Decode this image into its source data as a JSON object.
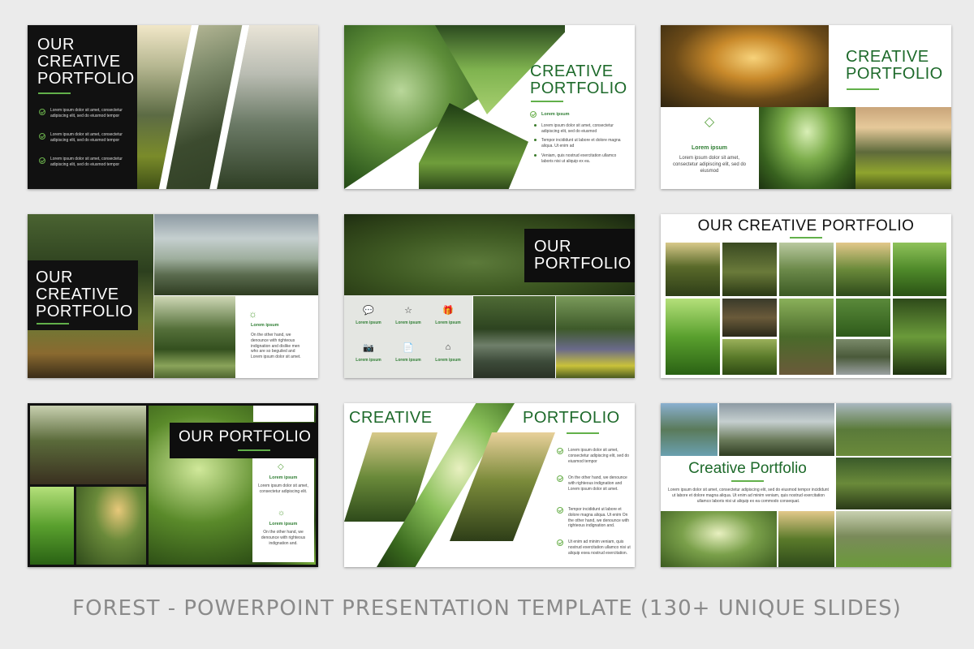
{
  "colors": {
    "brand_green": "#1e6a2b",
    "accent_green": "#62b04a",
    "dark": "#101010"
  },
  "slides": [
    {
      "title": "OUR\nCREATIVE\nPORTFOLIO",
      "bullets": [
        "Lorem ipsum dolor sit amet, consectetur adipiscing elit, sed do eiusmod tempor",
        "Lorem ipsum dolor sit amet, consectetur adipiscing elit, sed do eiusmod tempor",
        "Lorem ipsum dolor sit amet, consectetur adipiscing elit, sed do eiusmod tempor"
      ]
    },
    {
      "title": "CREATIVE\nPORTFOLIO",
      "heading": "Lorem ipsum",
      "bullets": [
        "Lorem ipsum dolor sit amet, consectetur adipiscing elit, sed do eiusmod",
        "Tempor incididunt ut labore et dolore magna aliqua. Ut enim ad",
        "Veniam, quis nostrud exercitation ullamco laboris nisi ut aliquip ex ea."
      ]
    },
    {
      "title": "CREATIVE\nPORTFOLIO",
      "heading": "Lorem ipsum",
      "body": "Lorem ipsum dolor sit amet, consectetur adipiscing elit, sed do eiusmod",
      "icon": "diamond-icon"
    },
    {
      "title": "OUR\nCREATIVE\nPORTFOLIO",
      "heading": "Lorem ipsum",
      "body": "On the other hand, we denounce with righteous indignation and dislike men who are so beguiled and Lorem ipsum dolor sit amet.",
      "icon": "sun-icon"
    },
    {
      "title": "OUR\nPORTFOLIO",
      "icons": [
        {
          "icon": "chat-icon",
          "glyph": "💬",
          "label": "Lorem ipsum"
        },
        {
          "icon": "star-icon",
          "glyph": "☆",
          "label": "Lorem ipsum"
        },
        {
          "icon": "gift-icon",
          "glyph": "🎁",
          "label": "Lorem ipsum"
        },
        {
          "icon": "camera-icon",
          "glyph": "📷",
          "label": "Lorem ipsum"
        },
        {
          "icon": "document-icon",
          "glyph": "📄",
          "label": "Lorem ipsum"
        },
        {
          "icon": "home-icon",
          "glyph": "⌂",
          "label": "Lorem ipsum"
        }
      ]
    },
    {
      "title": "OUR CREATIVE PORTFOLIO"
    },
    {
      "title": "OUR PORTFOLIO",
      "items": [
        {
          "icon": "diamond-icon",
          "heading": "Lorem ipsum",
          "body": "Lorem ipsum dolor sit amet, consectetur adipiscing elit."
        },
        {
          "icon": "sun-icon",
          "heading": "Lorem ipsum",
          "body": "On the other hand, we denounce with righteous indignation and."
        }
      ]
    },
    {
      "title_left": "CREATIVE",
      "title_right": "PORTFOLIO",
      "bullets": [
        "Lorem ipsum dolor sit amet, consectetur adipiscing elit, sed do eiusmod tempor",
        "On the other hand, we denounce with righteous indignation and Lorem ipsum dolor sit amet.",
        "Tempor incididunt ut labore et dolore magna aliqua. Ut enim On the other hand, we denounce with righteous indignation and.",
        "Ut enim ad minim veniam, quis nostrud exercitation ullamco nisi ut aliquip exea nostrud exercitation."
      ]
    },
    {
      "title": "Creative Portfolio",
      "body": "Lorem ipsum dolor sit amet, consectetur adipiscing elit, sed do eiusmod tempor incididunt ut labore et dolore magna aliqua. Ut enim ad minim veniam, quis nostrud exercitation ullamco laboris nisi ut aliquip ex ea commodo consequat."
    }
  ],
  "footer": "FOREST - POWERPOINT PRESENTATION TEMPLATE  (130+ UNIQUE SLIDES)"
}
